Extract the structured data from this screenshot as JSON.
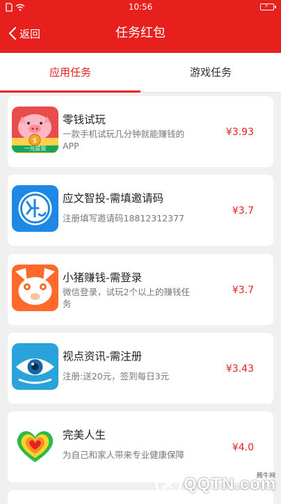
{
  "status_bar": {
    "time": "10:56"
  },
  "header": {
    "back_label": "返回",
    "title": "任务红包"
  },
  "tabs": [
    {
      "label": "应用任务",
      "active": true
    },
    {
      "label": "游戏任务",
      "active": false
    }
  ],
  "tasks": [
    {
      "name": "零钱试玩",
      "desc": "一款手机试玩几分钟就能赚钱的APP",
      "reward": "¥3.93",
      "icon": "piggy-bank-icon",
      "icon_text": "一元提现"
    },
    {
      "name": "应文智投-需填邀请码",
      "desc": "注册填写邀请码18812312377",
      "reward": "¥3.7",
      "icon": "yingwen-logo-icon"
    },
    {
      "name": "小猪赚钱-需登录",
      "desc": "微信登录，试玩2个以上的赚钱任务",
      "reward": "¥3.7",
      "icon": "pig-face-icon"
    },
    {
      "name": "视点资讯-需注册",
      "desc": "注册:送20元，签到每日3元",
      "reward": "¥3.43",
      "icon": "eye-icon"
    },
    {
      "name": "完美人生",
      "desc": "为自己和家人带来专业健康保障",
      "reward": "¥4.0",
      "icon": "rainbow-heart-icon"
    }
  ],
  "watermark": {
    "text": "QQTN.com",
    "sub_text": "腾牛网"
  },
  "colors": {
    "brand_red": "#e8201d",
    "reward_red": "#e8201d"
  }
}
